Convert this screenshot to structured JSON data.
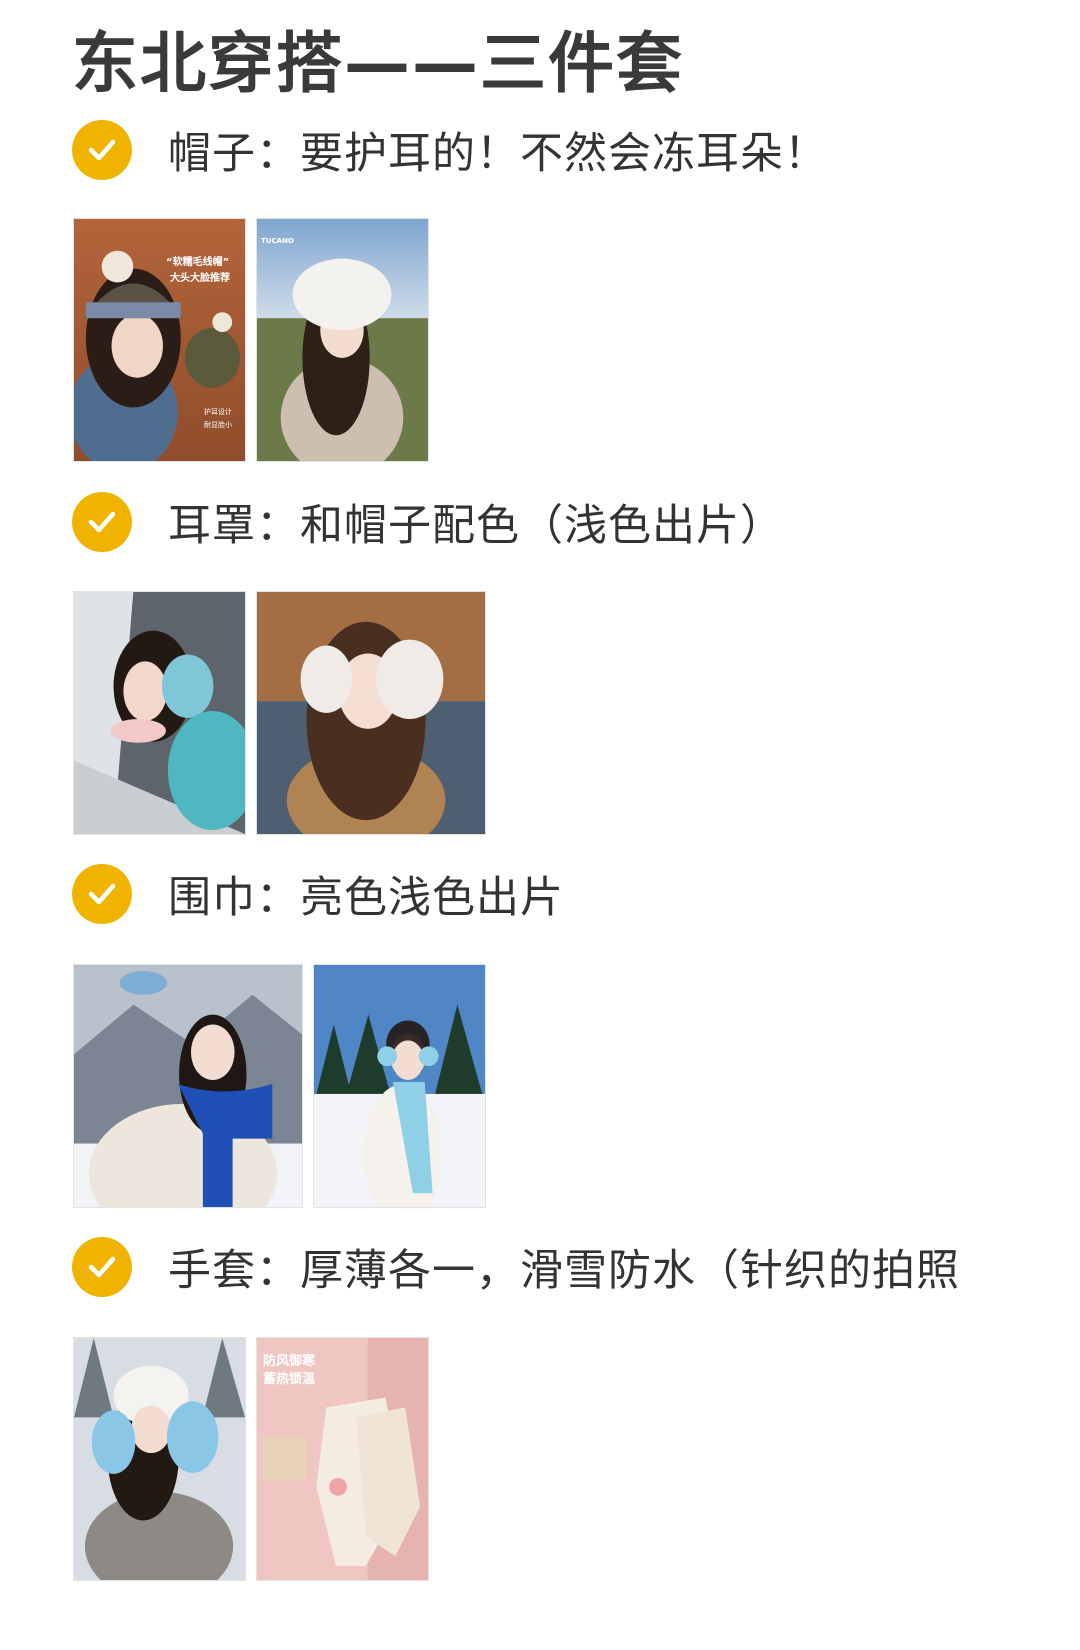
{
  "title": "东北穿搭——三件套",
  "sections": [
    {
      "label": "帽子：要护耳的！不然会冻耳朵！",
      "photos": [
        {
          "caption_line1": "“软糯毛线帽”",
          "caption_line2": "大头大脸推荐",
          "badge1": "护耳设计",
          "badge2": "耐显脸小"
        },
        {
          "brand": "TUCANO"
        }
      ]
    },
    {
      "label": "耳罩：和帽子配色（浅色出片）",
      "photos": [
        {},
        {}
      ]
    },
    {
      "label": "围巾：亮色浅色出片",
      "photos": [
        {},
        {}
      ]
    },
    {
      "label": "手套：厚薄各一，滑雪防水（针织的拍照",
      "photos": [
        {},
        {
          "ad_line1": "防风御寒",
          "ad_line2": "蓄热锁温"
        }
      ]
    }
  ],
  "colors": {
    "check": "#f0b400",
    "title": "#3a3a3a",
    "text": "#333333"
  },
  "icons": {
    "check": "checkmark-icon"
  }
}
